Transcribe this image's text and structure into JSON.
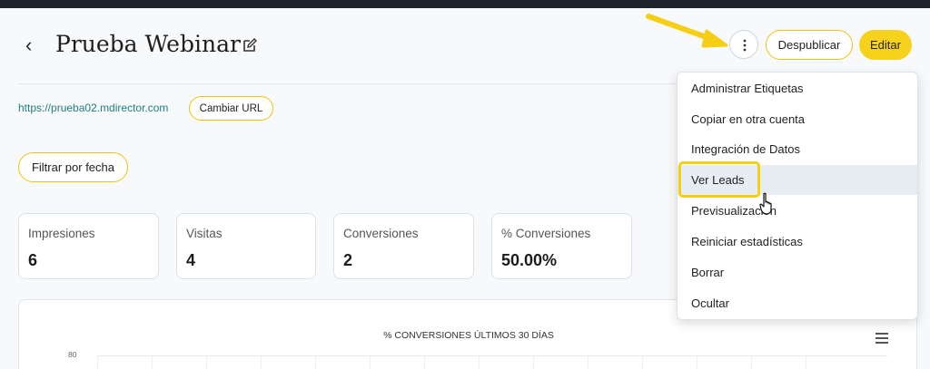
{
  "header": {
    "back_glyph": "‹",
    "title": "Prueba Webinar",
    "despublicar_label": "Despublicar",
    "editar_label": "Editar"
  },
  "url_bar": {
    "url": "https://prueba02.mdirector.com",
    "change_url_label": "Cambiar URL"
  },
  "filter": {
    "label": "Filtrar por fecha"
  },
  "stats": [
    {
      "label": "Impresiones",
      "value": "6"
    },
    {
      "label": "Visitas",
      "value": "4"
    },
    {
      "label": "Conversiones",
      "value": "2"
    },
    {
      "label": "% Conversiones",
      "value": "50.00%"
    }
  ],
  "chart": {
    "title": "% CONVERSIONES ÚLTIMOS 30 DÍAS",
    "y_tick_top": "80"
  },
  "dropdown": {
    "items": [
      "Administrar Etiquetas",
      "Copiar en otra cuenta",
      "Integración de Datos",
      "Ver Leads",
      "Previsualización",
      "Reiniciar estadísticas",
      "Borrar",
      "Ocultar"
    ]
  },
  "colors": {
    "accent": "#f7d21c",
    "link": "#1d7e83",
    "annotation": "#f6cf14"
  },
  "icons": [
    "back-chevron-icon",
    "edit-icon",
    "more-vertical-icon",
    "hamburger-menu-icon",
    "arrow-annotation-icon",
    "pointer-cursor-icon"
  ]
}
